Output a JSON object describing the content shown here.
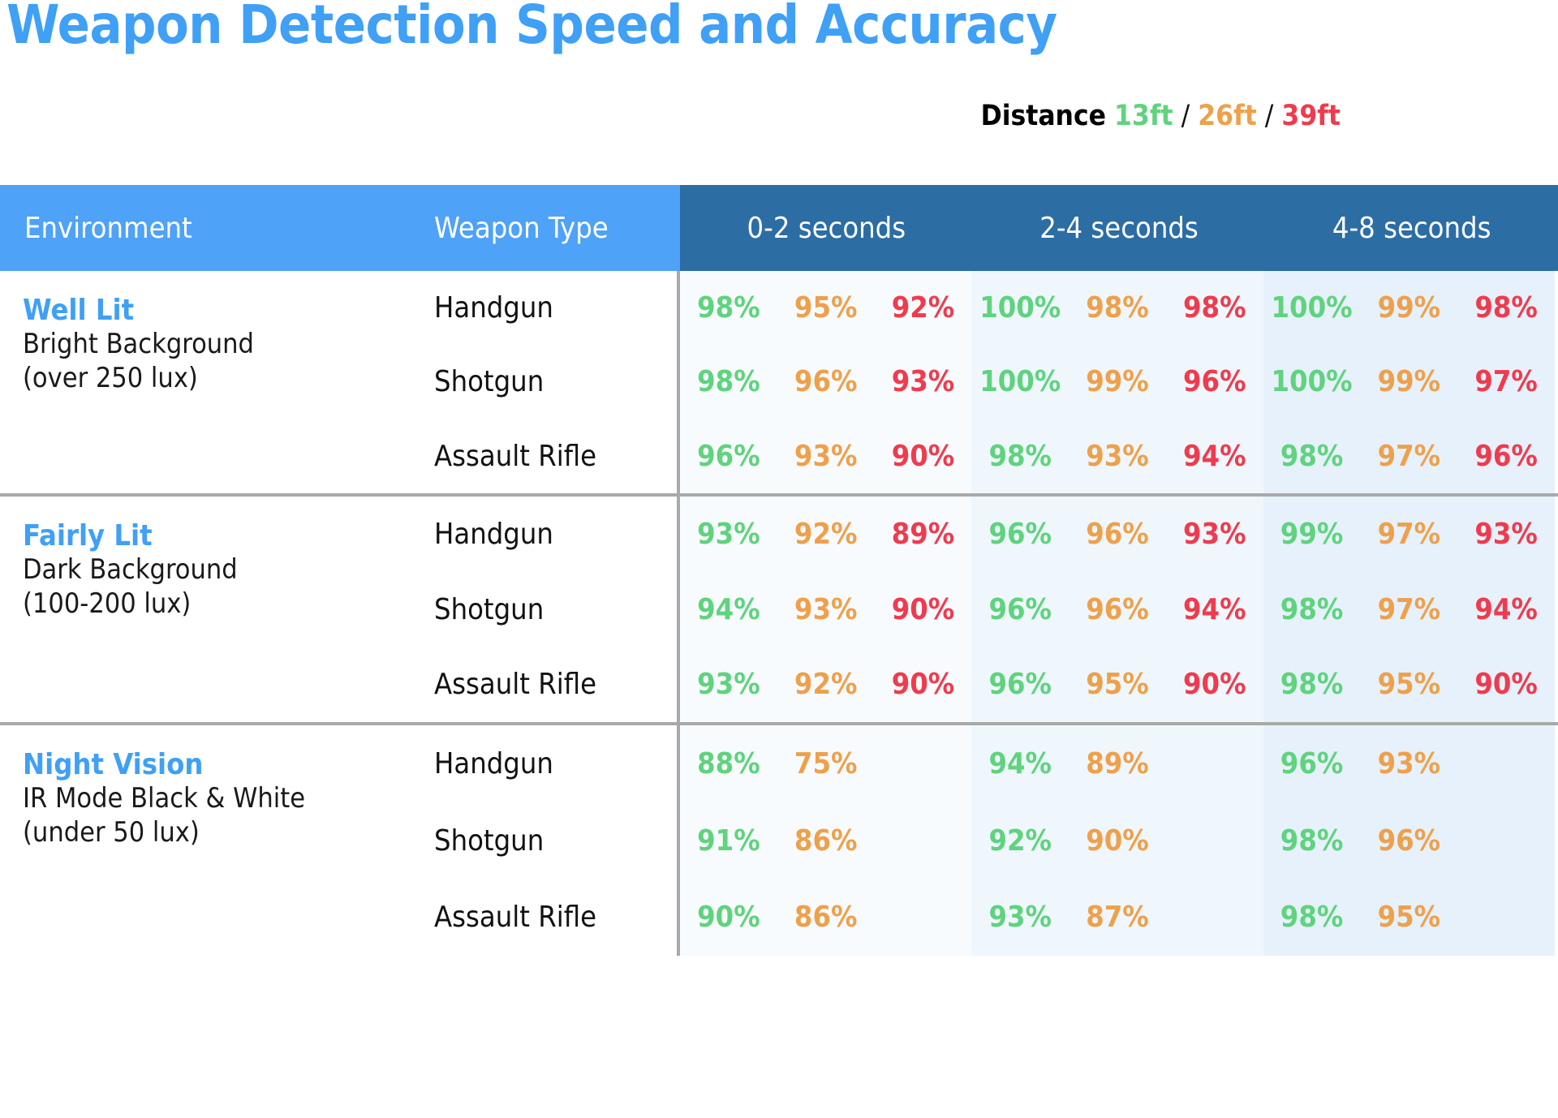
{
  "title": "Weapon Detection Speed and Accuracy",
  "legend": {
    "label": "Distance",
    "sep1": "/",
    "sep2": "/",
    "d1": "13ft",
    "d2": "26ft",
    "d3": "39ft",
    "colors": {
      "d1": "#5fd37d",
      "d2": "#efa04b",
      "d3": "#ef3b4e"
    }
  },
  "header": {
    "environment": "Environment",
    "weapon_type": "Weapon Type",
    "times": [
      "0-2 seconds",
      "2-4 seconds",
      "4-8 seconds"
    ],
    "colors": {
      "left": "#4ea2f7",
      "right": "#2c6da4"
    }
  },
  "chart_data": {
    "type": "table",
    "title": "Weapon Detection Speed and Accuracy",
    "row_headers": [
      "Environment",
      "Weapon Type"
    ],
    "column_groups": [
      "0-2 seconds",
      "2-4 seconds",
      "4-8 seconds"
    ],
    "sub_columns": [
      "13ft",
      "26ft",
      "39ft"
    ],
    "groups": [
      {
        "name": "Well Lit",
        "sub1": "Bright Background",
        "sub2": "(over 250 lux)",
        "rows": [
          {
            "weapon": "Handgun",
            "values": [
              [
                "98%",
                "95%",
                "92%"
              ],
              [
                "100%",
                "98%",
                "98%"
              ],
              [
                "100%",
                "99%",
                "98%"
              ]
            ]
          },
          {
            "weapon": "Shotgun",
            "values": [
              [
                "98%",
                "96%",
                "93%"
              ],
              [
                "100%",
                "99%",
                "96%"
              ],
              [
                "100%",
                "99%",
                "97%"
              ]
            ]
          },
          {
            "weapon": "Assault Rifle",
            "values": [
              [
                "96%",
                "93%",
                "90%"
              ],
              [
                "98%",
                "93%",
                "94%"
              ],
              [
                "98%",
                "97%",
                "96%"
              ]
            ]
          }
        ]
      },
      {
        "name": "Fairly Lit",
        "sub1": "Dark Background",
        "sub2": "(100-200  lux)",
        "rows": [
          {
            "weapon": "Handgun",
            "values": [
              [
                "93%",
                "92%",
                "89%"
              ],
              [
                "96%",
                "96%",
                "93%"
              ],
              [
                "99%",
                "97%",
                "93%"
              ]
            ]
          },
          {
            "weapon": "Shotgun",
            "values": [
              [
                "94%",
                "93%",
                "90%"
              ],
              [
                "96%",
                "96%",
                "94%"
              ],
              [
                "98%",
                "97%",
                "94%"
              ]
            ]
          },
          {
            "weapon": "Assault Rifle",
            "values": [
              [
                "93%",
                "92%",
                "90%"
              ],
              [
                "96%",
                "95%",
                "90%"
              ],
              [
                "98%",
                "95%",
                "90%"
              ]
            ]
          }
        ]
      },
      {
        "name": "Night Vision",
        "sub1": "IR Mode Black & White",
        "sub2": "(under 50 lux)",
        "rows": [
          {
            "weapon": "Handgun",
            "values": [
              [
                "88%",
                "75%",
                ""
              ],
              [
                "94%",
                "89%",
                ""
              ],
              [
                "96%",
                "93%",
                ""
              ]
            ]
          },
          {
            "weapon": "Shotgun",
            "values": [
              [
                "91%",
                "86%",
                ""
              ],
              [
                "92%",
                "90%",
                ""
              ],
              [
                "98%",
                "96%",
                ""
              ]
            ]
          },
          {
            "weapon": "Assault Rifle",
            "values": [
              [
                "90%",
                "86%",
                ""
              ],
              [
                "93%",
                "87%",
                ""
              ],
              [
                "98%",
                "95%",
                ""
              ]
            ]
          }
        ]
      }
    ]
  }
}
